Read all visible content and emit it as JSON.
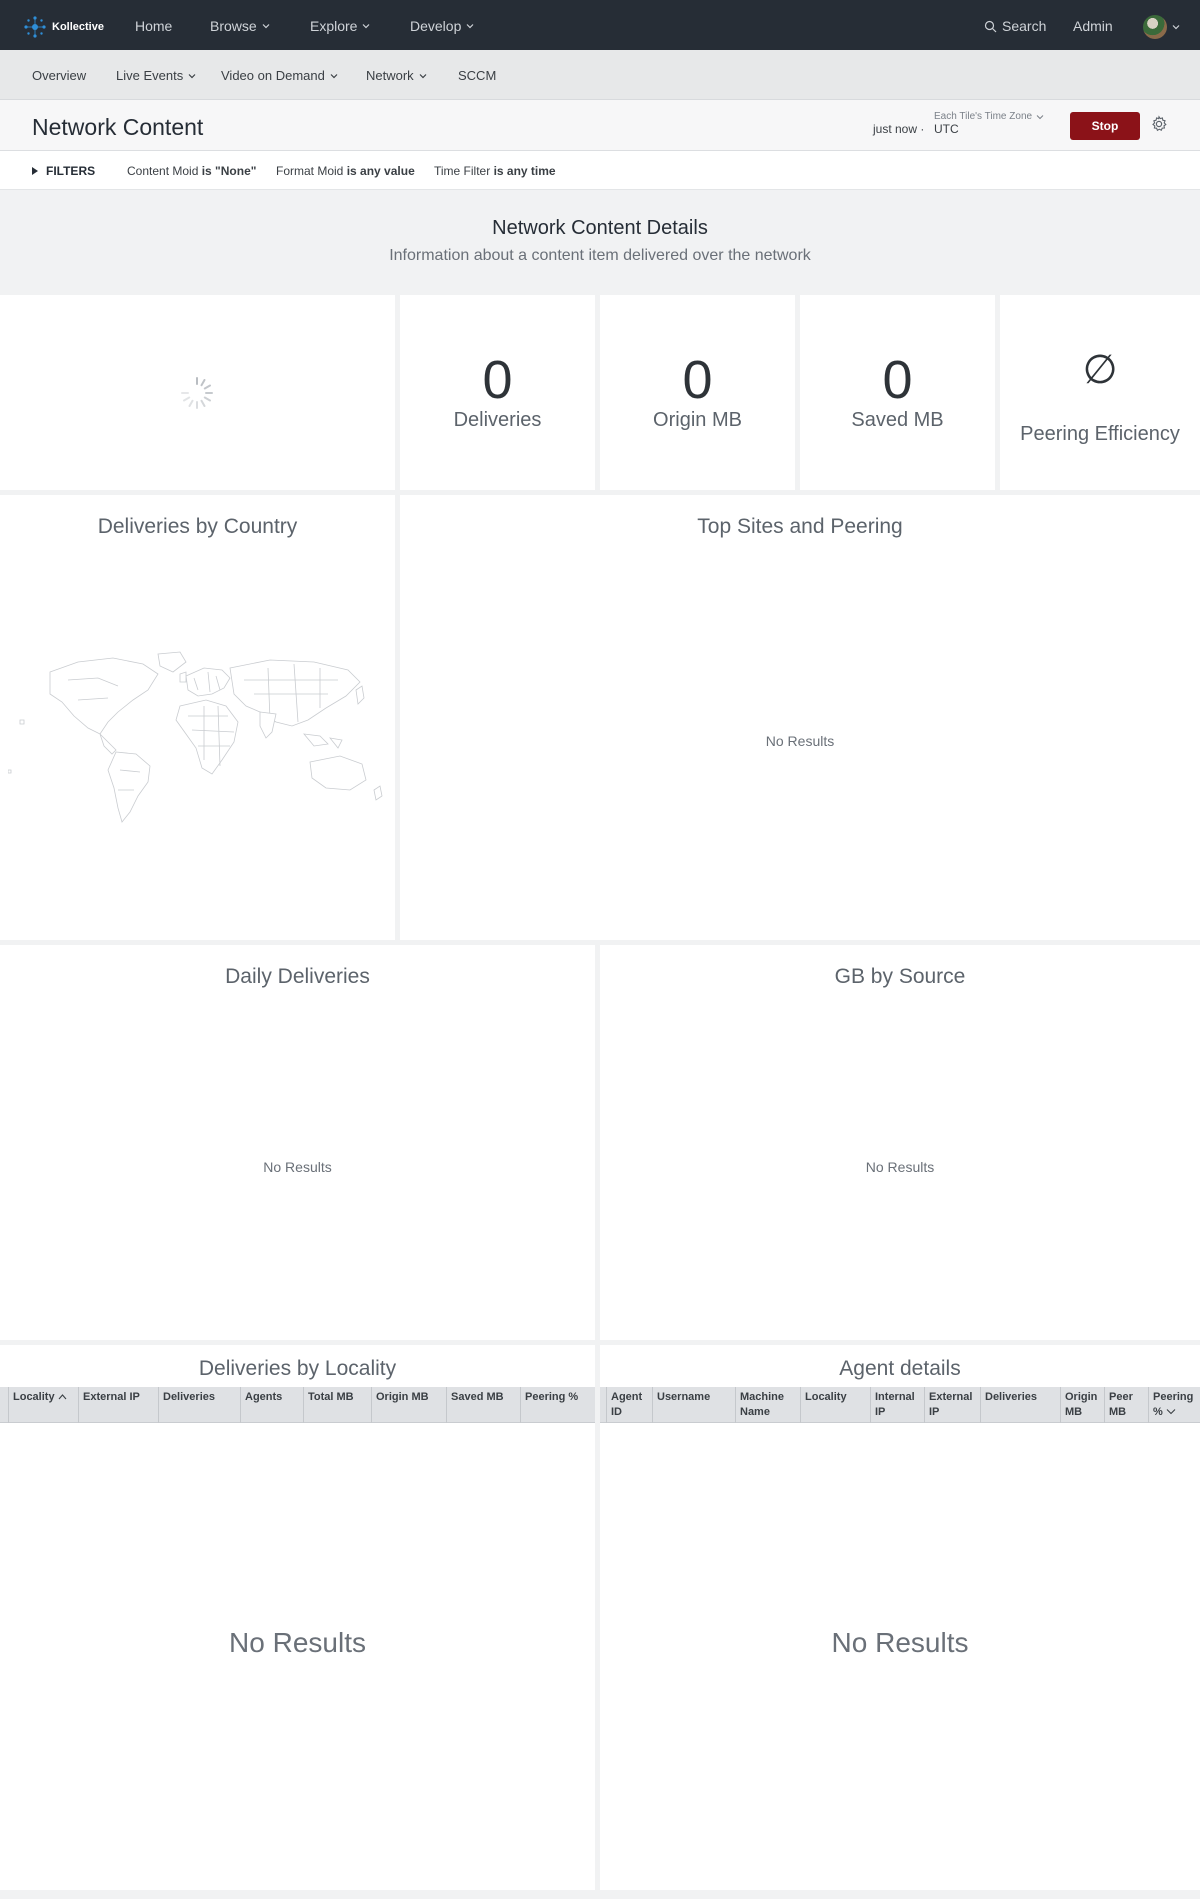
{
  "app": {
    "name": "Kollective"
  },
  "topnav": {
    "items": [
      {
        "label": "Home"
      },
      {
        "label": "Browse"
      },
      {
        "label": "Explore"
      },
      {
        "label": "Develop"
      }
    ],
    "search_label": "Search",
    "admin_label": "Admin"
  },
  "subnav": {
    "items": [
      {
        "label": "Overview"
      },
      {
        "label": "Live Events"
      },
      {
        "label": "Video on Demand"
      },
      {
        "label": "Network"
      },
      {
        "label": "SCCM"
      }
    ]
  },
  "header": {
    "title": "Network Content",
    "timezone_label": "Each Tile's Time Zone",
    "updated": "just now",
    "timezone": "UTC",
    "stop_label": "Stop"
  },
  "filters": {
    "label": "FILTERS",
    "chips": [
      {
        "field": "Content Moid",
        "condition": "is \"None\""
      },
      {
        "field": "Format Moid",
        "condition": "is any value"
      },
      {
        "field": "Time Filter",
        "condition": "is any time"
      }
    ]
  },
  "dashboard": {
    "title": "Network Content Details",
    "subtitle": "Information about a content item delivered over the network"
  },
  "kpis": {
    "deliveries": {
      "value": "0",
      "label": "Deliveries"
    },
    "origin_mb": {
      "value": "0",
      "label": "Origin MB"
    },
    "saved_mb": {
      "value": "0",
      "label": "Saved MB"
    },
    "peering_efficiency": {
      "value": "∅",
      "label": "Peering Efficiency"
    }
  },
  "tiles": {
    "deliveries_by_country": {
      "title": "Deliveries by Country"
    },
    "top_sites": {
      "title": "Top Sites and Peering",
      "empty": "No Results"
    },
    "daily_deliveries": {
      "title": "Daily Deliveries",
      "empty": "No Results"
    },
    "gb_by_source": {
      "title": "GB by Source",
      "empty": "No Results"
    },
    "deliveries_by_locality": {
      "title": "Deliveries by Locality",
      "columns": [
        "Locality",
        "External IP",
        "Deliveries",
        "Agents",
        "Total MB",
        "Origin MB",
        "Saved MB",
        "Peering %"
      ],
      "empty": "No Results"
    },
    "agent_details": {
      "title": "Agent details",
      "columns": [
        "Agent ID",
        "Username",
        "Machine Name",
        "Locality",
        "Internal IP",
        "External IP",
        "Deliveries",
        "Origin MB",
        "Peer MB",
        "Peering %"
      ],
      "empty": "No Results"
    }
  },
  "colors": {
    "topnav_bg": "#262d36",
    "stop_button": "#8b1218",
    "brand_blue": "#2f8fd8"
  }
}
